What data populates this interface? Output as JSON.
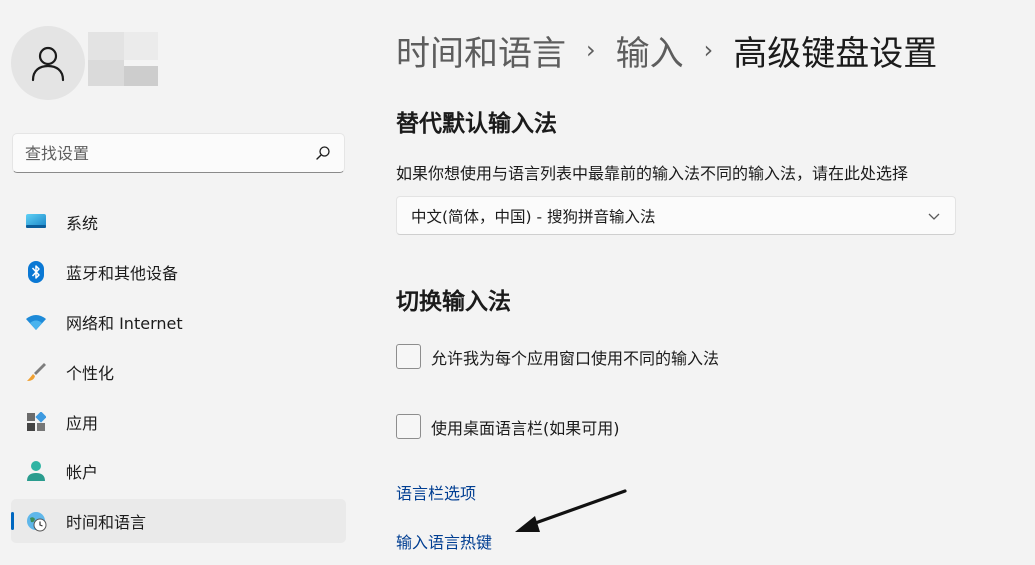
{
  "sidebar": {
    "search": {
      "placeholder": "查找设置"
    },
    "items": [
      {
        "label": "系统",
        "icon": "monitor-icon"
      },
      {
        "label": "蓝牙和其他设备",
        "icon": "bluetooth-icon"
      },
      {
        "label": "网络和 Internet",
        "icon": "wifi-icon"
      },
      {
        "label": "个性化",
        "icon": "brush-icon"
      },
      {
        "label": "应用",
        "icon": "apps-icon"
      },
      {
        "label": "帐户",
        "icon": "account-icon"
      },
      {
        "label": "时间和语言",
        "icon": "clock-globe-icon",
        "active": true
      }
    ]
  },
  "breadcrumb": {
    "level1": "时间和语言",
    "level2": "输入",
    "current": "高级键盘设置",
    "separator": "›"
  },
  "override": {
    "title": "替代默认输入法",
    "description": "如果你想使用与语言列表中最靠前的输入法不同的输入法，请在此处选择",
    "dropdown_value": "中文(简体，中国) - 搜狗拼音输入法"
  },
  "switching": {
    "title": "切换输入法",
    "checkbox1": {
      "label": "允许我为每个应用窗口使用不同的输入法",
      "checked": false
    },
    "checkbox2": {
      "label": "使用桌面语言栏(如果可用)",
      "checked": false
    }
  },
  "links": {
    "language_bar_options": "语言栏选项",
    "input_language_hotkeys": "输入语言热键"
  },
  "colors": {
    "accent": "#0067c0",
    "link": "#003e92",
    "background": "#f3f3f3"
  }
}
